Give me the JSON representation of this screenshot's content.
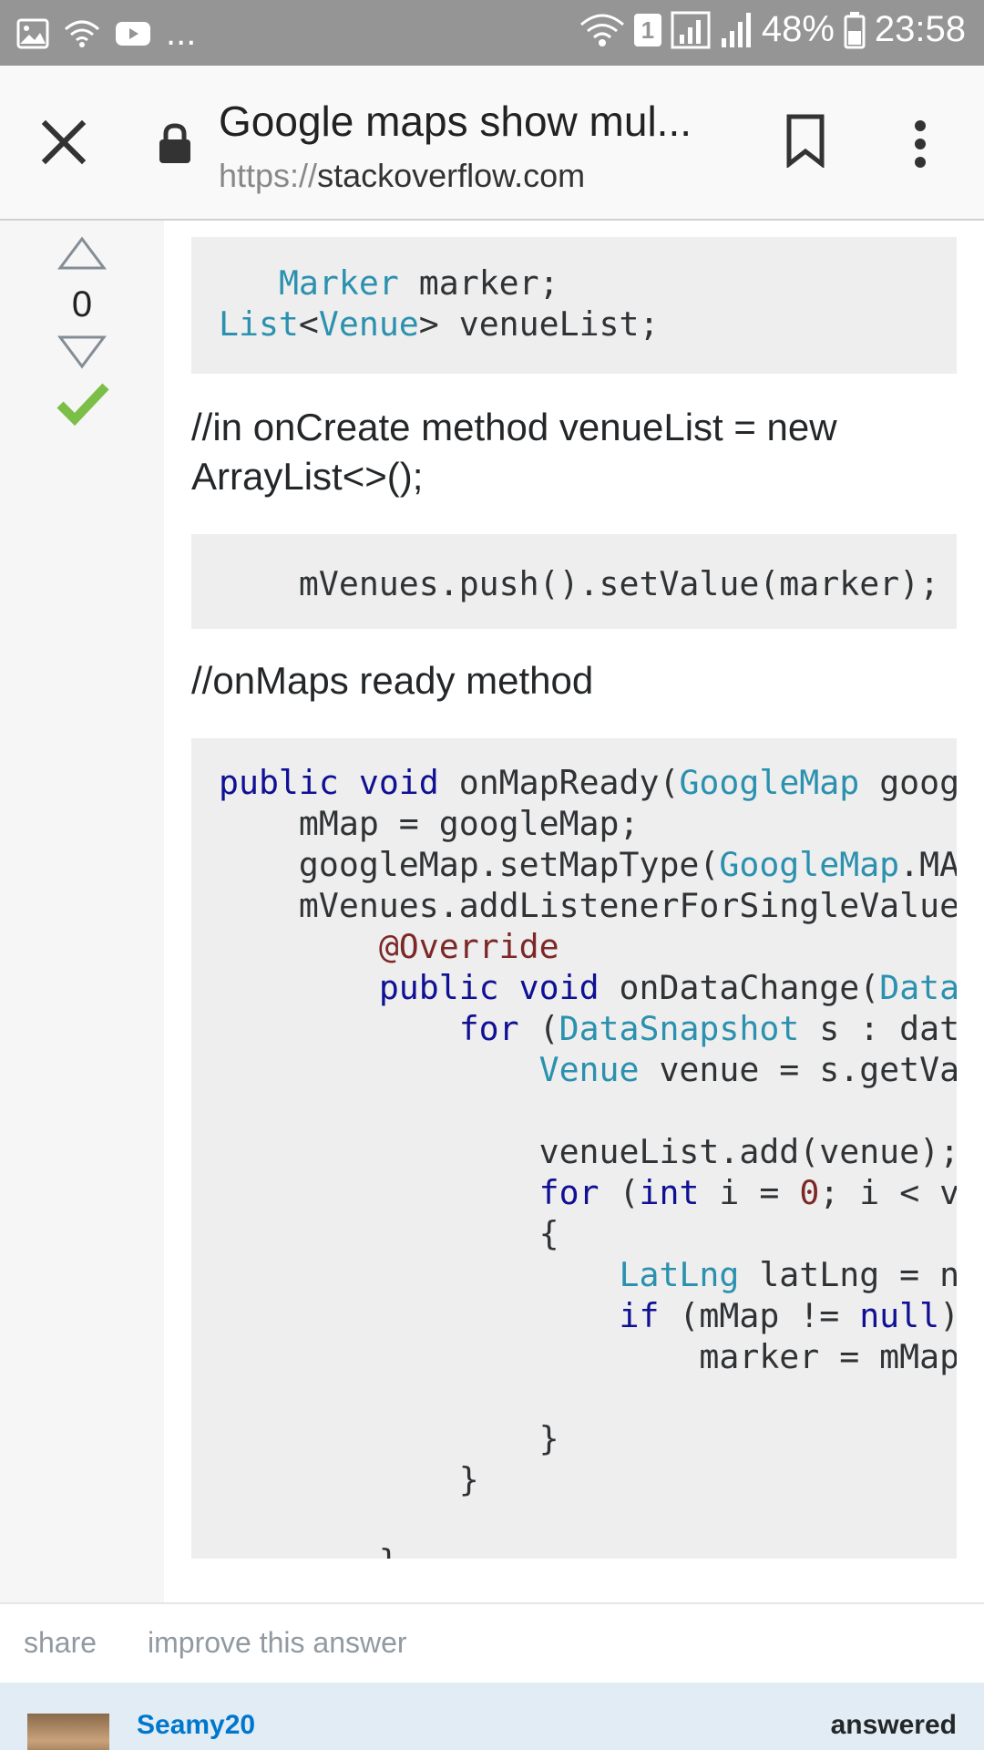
{
  "status_bar": {
    "battery": "48%",
    "time": "23:58",
    "sim": "1",
    "left_icons": [
      "image-icon",
      "wifi-call-icon",
      "youtube-icon"
    ],
    "more": "..."
  },
  "toolbar": {
    "title": "Google maps show mul...",
    "url_scheme": "https://",
    "url_host": "stackoverflow.com"
  },
  "vote": {
    "count": "0"
  },
  "post": {
    "code_block_1": [
      [
        {
          "t": "   "
        },
        {
          "t": "Marker",
          "c": "ty"
        },
        {
          "t": " marker;"
        }
      ],
      [
        {
          "t": "List",
          "c": "ty"
        },
        {
          "t": "<"
        },
        {
          "t": "Venue",
          "c": "ty"
        },
        {
          "t": "> venueList;"
        }
      ]
    ],
    "paragraph_1": "//in onCreate method venueList = new ArrayList<>();",
    "code_block_2": [
      [
        {
          "t": "    mVenues.push().setValue(marker);"
        }
      ]
    ],
    "paragraph_2": "//onMaps ready method",
    "code_block_3": [
      [
        {
          "t": "public",
          "c": "kw"
        },
        {
          "t": " "
        },
        {
          "t": "void",
          "c": "kw"
        },
        {
          "t": " onMapReady("
        },
        {
          "t": "GoogleMap",
          "c": "ty"
        },
        {
          "t": " googleMap) {"
        }
      ],
      [
        {
          "t": "    mMap = googleMap;"
        }
      ],
      [
        {
          "t": "    googleMap.setMapType("
        },
        {
          "t": "GoogleMap",
          "c": "ty"
        },
        {
          "t": ".MAP_TYPE_NORMAL);"
        }
      ],
      [
        {
          "t": "    mVenues.addListenerForSingleValueEvent("
        }
      ],
      [
        {
          "t": "        "
        },
        {
          "t": "@Override",
          "c": "an"
        }
      ],
      [
        {
          "t": "        "
        },
        {
          "t": "public",
          "c": "kw"
        },
        {
          "t": " "
        },
        {
          "t": "void",
          "c": "kw"
        },
        {
          "t": " onDataChange("
        },
        {
          "t": "DataSnapshot",
          "c": "ty"
        },
        {
          "t": " dataSnapshot) {"
        }
      ],
      [
        {
          "t": "            "
        },
        {
          "t": "for",
          "c": "kw"
        },
        {
          "t": " ("
        },
        {
          "t": "DataSnapshot",
          "c": "ty"
        },
        {
          "t": " s : dataSnapshot"
        }
      ],
      [
        {
          "t": "                "
        },
        {
          "t": "Venue",
          "c": "ty"
        },
        {
          "t": " venue = s.getValue("
        }
      ],
      [
        {
          "t": ""
        }
      ],
      [
        {
          "t": "                venueList.add(venue);"
        }
      ],
      [
        {
          "t": "                "
        },
        {
          "t": "for",
          "c": "kw"
        },
        {
          "t": " ("
        },
        {
          "t": "int",
          "c": "kw"
        },
        {
          "t": " i = "
        },
        {
          "t": "0",
          "c": "num"
        },
        {
          "t": "; i < venueList"
        }
      ],
      [
        {
          "t": "                {"
        }
      ],
      [
        {
          "t": "                    "
        },
        {
          "t": "LatLng",
          "c": "ty"
        },
        {
          "t": " latLng = new"
        }
      ],
      [
        {
          "t": "                    "
        },
        {
          "t": "if",
          "c": "kw"
        },
        {
          "t": " (mMap != "
        },
        {
          "t": "null",
          "c": "kw"
        },
        {
          "t": ") {"
        }
      ],
      [
        {
          "t": "                        marker = mMap.addMarker("
        }
      ],
      [
        {
          "t": ""
        }
      ],
      [
        {
          "t": "                }"
        }
      ],
      [
        {
          "t": "            }"
        }
      ],
      [
        {
          "t": ""
        }
      ],
      [
        {
          "t": "        }"
        }
      ]
    ]
  },
  "actions": {
    "share": "share",
    "improve": "improve this answer"
  },
  "user_card": {
    "name": "Seamy20",
    "answered": "answered"
  }
}
